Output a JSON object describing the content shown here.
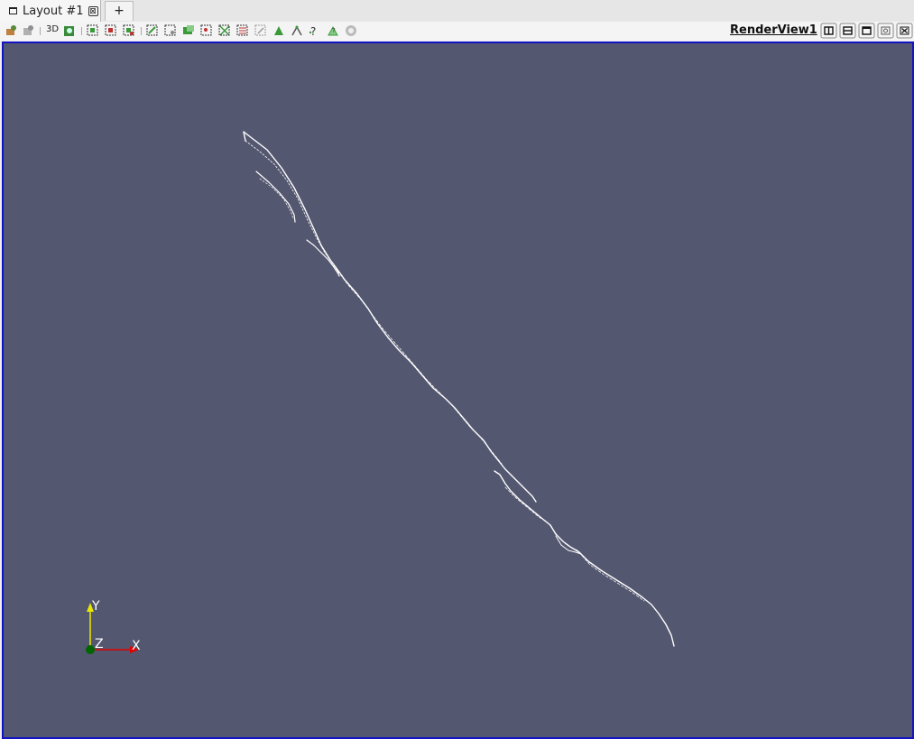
{
  "tabs": {
    "layout_label": "Layout #1",
    "close_glyph": "⊠",
    "add_label": "+"
  },
  "toolbar": {
    "mode_3d_label": "3D",
    "icons": [
      "reset-camera-icon",
      "zoom-data-icon",
      "camera-undo-icon",
      "camera-redo-icon",
      "select-cells-icon",
      "select-points-icon",
      "select-block-icon",
      "select-frustum-icon",
      "select-polygon-icon",
      "interactive-select-icon",
      "hover-points-icon",
      "hover-cells-icon",
      "grow-selection-icon",
      "shrink-selection-icon",
      "clear-selection-icon",
      "extract-selection-icon",
      "query-icon",
      "annotate-icon",
      "cancel-icon"
    ]
  },
  "render_view": {
    "title": "RenderView1",
    "background_color": "#545770",
    "axes": {
      "x_label": "X",
      "y_label": "Y",
      "z_label": "Z",
      "x_color": "#e00000",
      "y_color": "#e8e800",
      "z_color": "#006400"
    }
  },
  "view_controls": [
    "split-horizontal-icon",
    "split-vertical-icon",
    "maximize-icon",
    "capture-icon",
    "close-view-icon"
  ]
}
